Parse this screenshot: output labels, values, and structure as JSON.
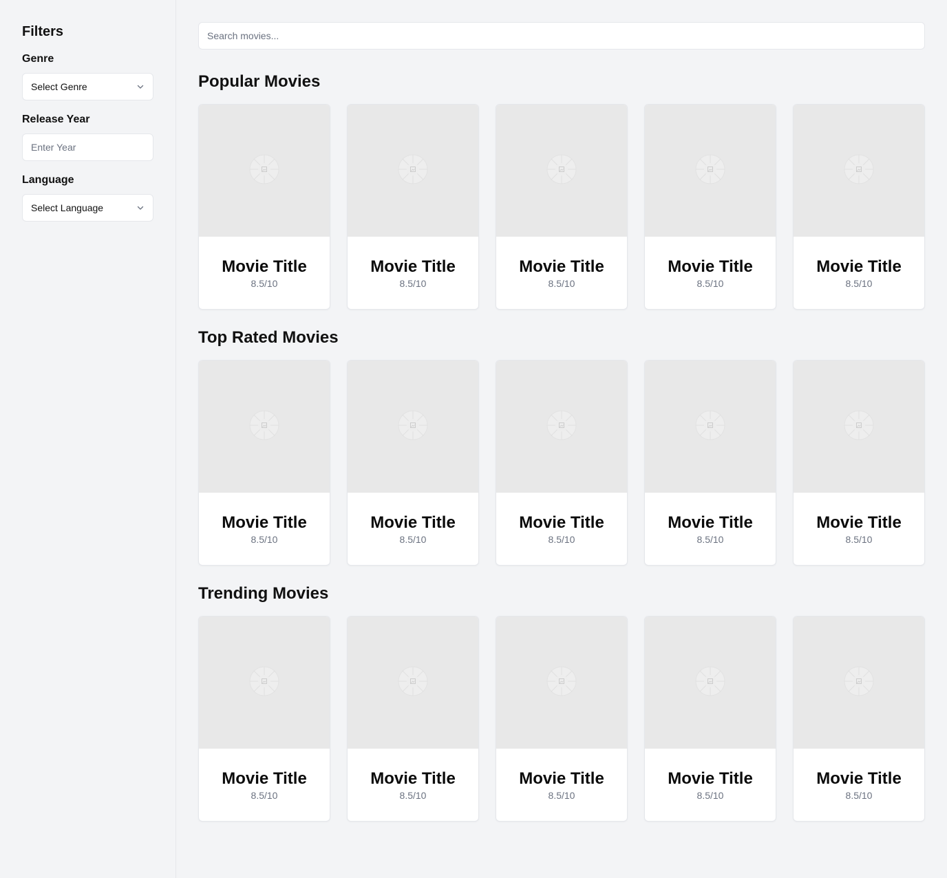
{
  "sidebar": {
    "title": "Filters",
    "genre": {
      "label": "Genre",
      "value": "Select Genre"
    },
    "year": {
      "label": "Release Year",
      "placeholder": "Enter Year"
    },
    "language": {
      "label": "Language",
      "value": "Select Language"
    }
  },
  "search": {
    "placeholder": "Search movies..."
  },
  "sections": [
    {
      "title": "Popular Movies",
      "movies": [
        {
          "title": "Movie Title",
          "rating": "8.5/10"
        },
        {
          "title": "Movie Title",
          "rating": "8.5/10"
        },
        {
          "title": "Movie Title",
          "rating": "8.5/10"
        },
        {
          "title": "Movie Title",
          "rating": "8.5/10"
        },
        {
          "title": "Movie Title",
          "rating": "8.5/10"
        }
      ]
    },
    {
      "title": "Top Rated Movies",
      "movies": [
        {
          "title": "Movie Title",
          "rating": "8.5/10"
        },
        {
          "title": "Movie Title",
          "rating": "8.5/10"
        },
        {
          "title": "Movie Title",
          "rating": "8.5/10"
        },
        {
          "title": "Movie Title",
          "rating": "8.5/10"
        },
        {
          "title": "Movie Title",
          "rating": "8.5/10"
        }
      ]
    },
    {
      "title": "Trending Movies",
      "movies": [
        {
          "title": "Movie Title",
          "rating": "8.5/10"
        },
        {
          "title": "Movie Title",
          "rating": "8.5/10"
        },
        {
          "title": "Movie Title",
          "rating": "8.5/10"
        },
        {
          "title": "Movie Title",
          "rating": "8.5/10"
        },
        {
          "title": "Movie Title",
          "rating": "8.5/10"
        }
      ]
    }
  ],
  "icons": {
    "poster_placeholder": "image-placeholder-icon",
    "select_chevron": "chevron-down-icon"
  },
  "colors": {
    "background": "#f3f4f6",
    "card": "#ffffff",
    "poster": "#e8e8e8",
    "muted_text": "#6b7280",
    "border": "#e5e7eb"
  }
}
